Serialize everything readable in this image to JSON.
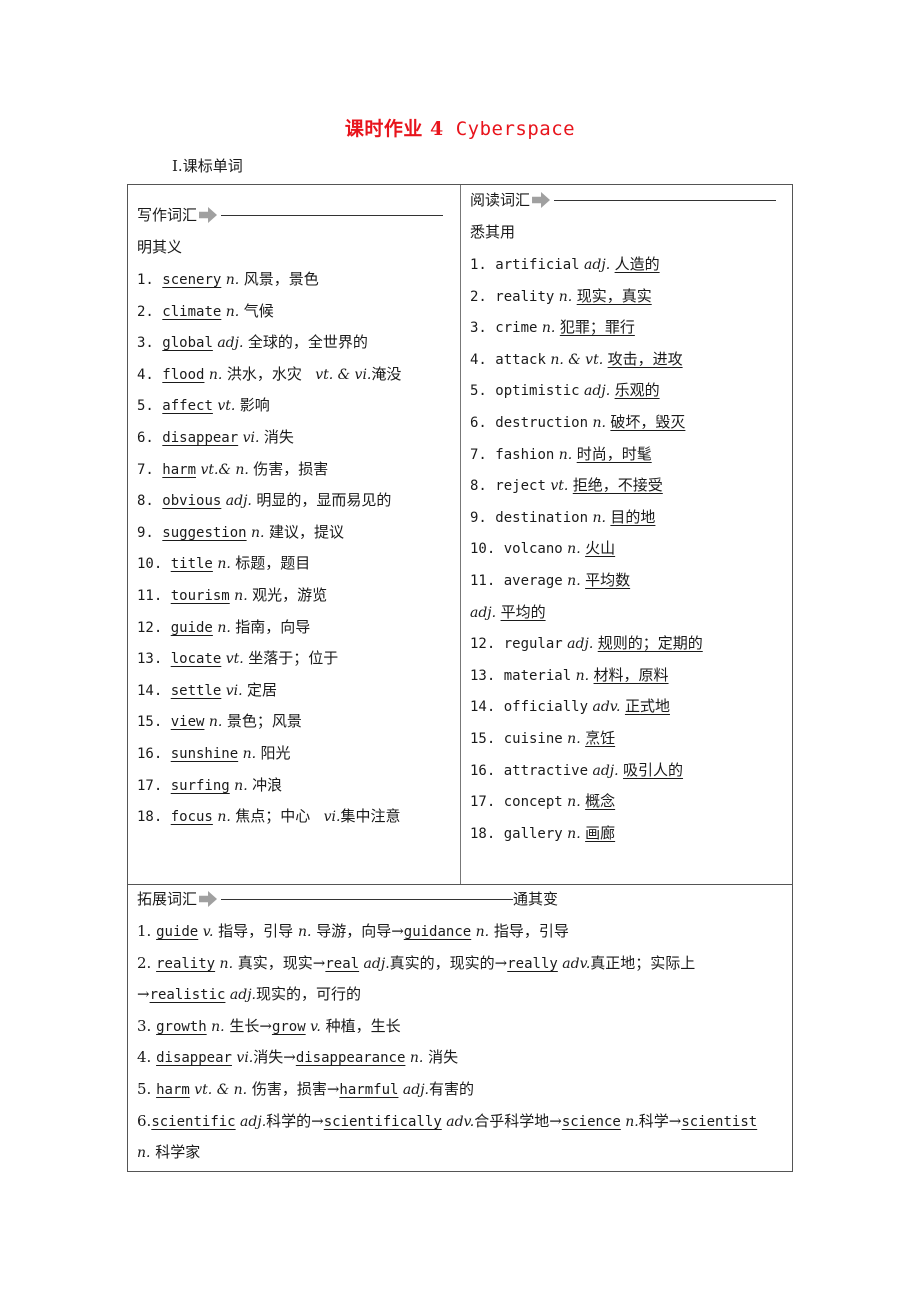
{
  "title": {
    "cn": "课时作业 4",
    "en": "Cyberspace"
  },
  "section": "Ⅰ.课标单词",
  "writing": {
    "header": "写作词汇",
    "arrow_icon": "right-arrow-icon",
    "subheader": "明其义",
    "items": [
      {
        "num": "1.",
        "word": "scenery",
        "pos": "n.",
        "meaning": "风景，景色"
      },
      {
        "num": "2.",
        "word": "climate",
        "pos": "n.",
        "meaning": "气候"
      },
      {
        "num": "3.",
        "word": "global",
        "pos": "adj.",
        "meaning": "全球的，全世界的"
      },
      {
        "num": "4.",
        "word": "flood",
        "pos": "n.",
        "meaning": "洪水，水灾",
        "pos2": "vt. & vi.",
        "meaning2": "淹没"
      },
      {
        "num": "5.",
        "word": "affect",
        "pos": "vt.",
        "meaning": "影响"
      },
      {
        "num": "6.",
        "word": "disappear",
        "pos": "vi.",
        "meaning": "消失"
      },
      {
        "num": "7.",
        "word": "harm",
        "pos": "vt.& n.",
        "meaning": "伤害，损害"
      },
      {
        "num": "8.",
        "word": "obvious",
        "pos": "adj.",
        "meaning": "明显的，显而易见的"
      },
      {
        "num": "9.",
        "word": "suggestion",
        "pos": "n.",
        "meaning": "建议，提议"
      },
      {
        "num": "10.",
        "word": "title",
        "pos": "n.",
        "meaning": "标题，题目"
      },
      {
        "num": "11.",
        "word": "tourism",
        "pos": "n.",
        "meaning": "观光，游览"
      },
      {
        "num": "12.",
        "word": "guide",
        "pos": "n.",
        "meaning": "指南，向导"
      },
      {
        "num": "13.",
        "word": "locate",
        "pos": "vt.",
        "meaning": "坐落于；位于"
      },
      {
        "num": "14.",
        "word": "settle",
        "pos": "vi.",
        "meaning": "定居"
      },
      {
        "num": "15.",
        "word": "view",
        "pos": "n.",
        "meaning": "景色；风景"
      },
      {
        "num": "16.",
        "word": "sunshine",
        "pos": "n.",
        "meaning": "阳光"
      },
      {
        "num": "17.",
        "word": "surfing",
        "pos": "n.",
        "meaning": "冲浪"
      },
      {
        "num": "18.",
        "word": "focus",
        "pos": "n.",
        "meaning": "焦点；中心",
        "pos2": "vi.",
        "meaning2": "集中注意"
      }
    ]
  },
  "reading": {
    "header": "阅读词汇",
    "arrow_icon": "right-arrow-icon",
    "subheader": "悉其用",
    "items": [
      {
        "num": "1.",
        "word": "artificial",
        "pos": "adj.",
        "meaning": "人造的"
      },
      {
        "num": "2.",
        "word": "reality",
        "pos": "n.",
        "meaning": "现实，真实"
      },
      {
        "num": "3.",
        "word": "crime",
        "pos": "n.",
        "meaning": "犯罪；罪行"
      },
      {
        "num": "4.",
        "word": "attack",
        "pos": "n. & vt.",
        "meaning": "攻击，进攻"
      },
      {
        "num": "5.",
        "word": "optimistic",
        "pos": "adj.",
        "meaning": "乐观的"
      },
      {
        "num": "6.",
        "word": "destruction",
        "pos": "n.",
        "meaning": "破坏，毁灭"
      },
      {
        "num": "7.",
        "word": "fashion",
        "pos": "n.",
        "meaning": "时尚，时髦"
      },
      {
        "num": "8.",
        "word": "reject",
        "pos": "vt.",
        "meaning": "拒绝，不接受"
      },
      {
        "num": "9.",
        "word": "destination",
        "pos": "n.",
        "meaning": "目的地"
      },
      {
        "num": "10.",
        "word": "volcano",
        "pos": "n.",
        "meaning": "火山"
      },
      {
        "num": "11.",
        "word": "average",
        "pos": "n.",
        "meaning": "平均数"
      },
      {
        "num": "",
        "word": "",
        "pos": "adj.",
        "meaning": "平均的"
      },
      {
        "num": "12.",
        "word": "regular",
        "pos": "adj.",
        "meaning": "规则的；定期的"
      },
      {
        "num": "13.",
        "word": "material",
        "pos": "n.",
        "meaning": "材料，原料"
      },
      {
        "num": "14.",
        "word": "officially",
        "pos": "adv.",
        "meaning": "正式地"
      },
      {
        "num": "15.",
        "word": "cuisine",
        "pos": "n.",
        "meaning": "烹饪"
      },
      {
        "num": "16.",
        "word": "attractive",
        "pos": "adj.",
        "meaning": "吸引人的"
      },
      {
        "num": "17.",
        "word": "concept",
        "pos": "n.",
        "meaning": "概念"
      },
      {
        "num": "18.",
        "word": "gallery",
        "pos": "n.",
        "meaning": "画廊"
      }
    ]
  },
  "extended": {
    "header": "拓展词汇",
    "arrow_icon": "right-arrow-icon",
    "subheader": "通其变",
    "lines": [
      [
        {
          "t": "1. "
        },
        {
          "t": "guide",
          "u": 1,
          "m": 1
        },
        {
          "t": " v.",
          "i": 1
        },
        {
          "t": " 指导，引导 "
        },
        {
          "t": "n.",
          "i": 1
        },
        {
          "t": " 导游，向导→"
        },
        {
          "t": "guidance",
          "u": 1,
          "m": 1
        },
        {
          "t": " n.",
          "i": 1
        },
        {
          "t": " 指导，引导"
        }
      ],
      [
        {
          "t": "2. "
        },
        {
          "t": "reality",
          "u": 1,
          "m": 1
        },
        {
          "t": " n.",
          "i": 1
        },
        {
          "t": " 真实，现实→"
        },
        {
          "t": "real",
          "u": 1,
          "m": 1
        },
        {
          "t": " adj.",
          "i": 1
        },
        {
          "t": "真实的，现实的→"
        },
        {
          "t": "really",
          "u": 1,
          "m": 1
        },
        {
          "t": " adv.",
          "i": 1
        },
        {
          "t": "真正地；实际上"
        }
      ],
      [
        {
          "t": "→"
        },
        {
          "t": "realistic",
          "u": 1,
          "m": 1
        },
        {
          "t": " adj.",
          "i": 1
        },
        {
          "t": "现实的，可行的"
        }
      ],
      [
        {
          "t": "3. "
        },
        {
          "t": "growth",
          "u": 1,
          "m": 1
        },
        {
          "t": " n.",
          "i": 1
        },
        {
          "t": " 生长→"
        },
        {
          "t": "grow",
          "u": 1,
          "m": 1
        },
        {
          "t": " v.",
          "i": 1
        },
        {
          "t": " 种植，生长"
        }
      ],
      [
        {
          "t": "4. "
        },
        {
          "t": "disappear",
          "u": 1,
          "m": 1
        },
        {
          "t": " vi.",
          "i": 1
        },
        {
          "t": "消失→"
        },
        {
          "t": "disappearance",
          "u": 1,
          "m": 1
        },
        {
          "t": " n.",
          "i": 1
        },
        {
          "t": " 消失"
        }
      ],
      [
        {
          "t": "5. "
        },
        {
          "t": "harm",
          "u": 1,
          "m": 1
        },
        {
          "t": " vt. & n.",
          "i": 1
        },
        {
          "t": " 伤害，损害→"
        },
        {
          "t": "harmful",
          "u": 1,
          "m": 1
        },
        {
          "t": " adj.",
          "i": 1
        },
        {
          "t": "有害的"
        }
      ],
      [
        {
          "t": "6."
        },
        {
          "t": "scientific",
          "u": 1,
          "m": 1
        },
        {
          "t": " adj.",
          "i": 1
        },
        {
          "t": "科学的→"
        },
        {
          "t": "scientifically",
          "u": 1,
          "m": 1
        },
        {
          "t": " adv.",
          "i": 1
        },
        {
          "t": "合乎科学地→"
        },
        {
          "t": "science",
          "u": 1,
          "m": 1
        },
        {
          "t": " n.",
          "i": 1
        },
        {
          "t": "科学→"
        },
        {
          "t": "scientist",
          "u": 1,
          "m": 1
        }
      ],
      [
        {
          "t": "n.",
          "i": 1
        },
        {
          "t": " 科学家"
        }
      ]
    ]
  }
}
